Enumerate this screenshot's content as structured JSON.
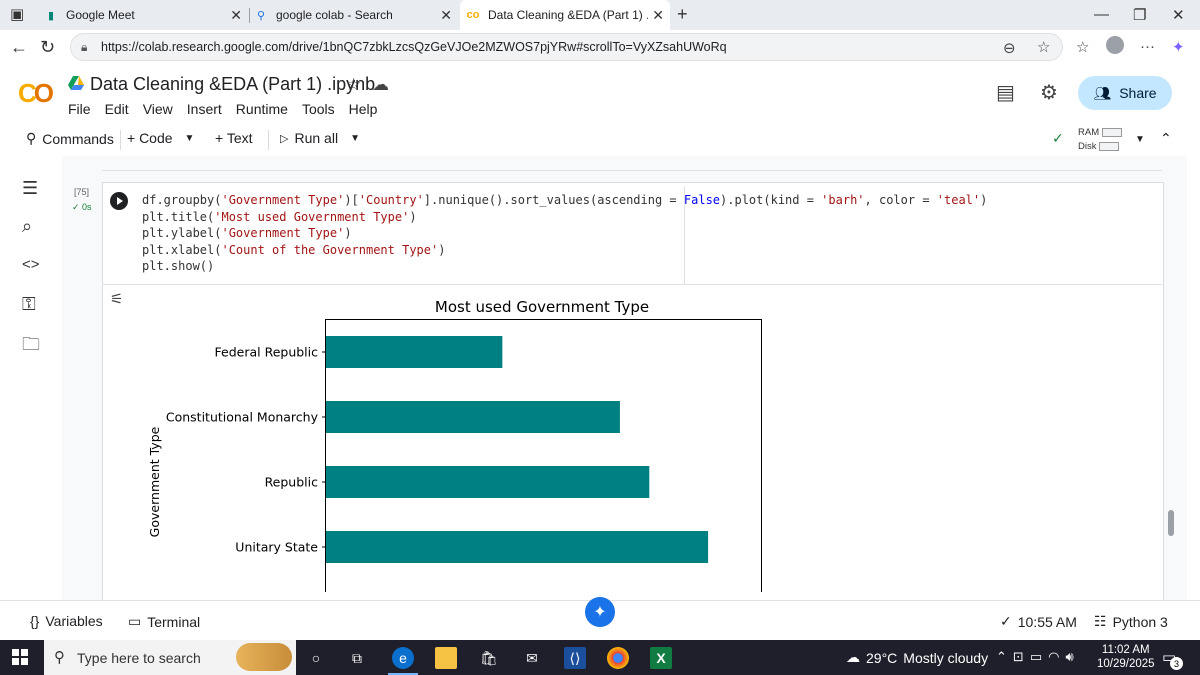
{
  "browser": {
    "tabs": [
      {
        "title": "Google Meet",
        "icon": "google-meet-icon",
        "active": false
      },
      {
        "title": "google colab - Search",
        "icon": "search-icon",
        "active": false
      },
      {
        "title": "Data Cleaning &EDA (Part 1) .ipyn",
        "icon": "colab-icon",
        "active": true
      }
    ],
    "url": "https://colab.research.google.com/drive/1bnQC7zbkLzcsQzGeVJOe2MZWOS7pjYRw#scrollTo=VyXZsahUWoRq"
  },
  "colab": {
    "title": "Data Cleaning &EDA (Part 1) .ipynb",
    "menus": [
      "File",
      "Edit",
      "View",
      "Insert",
      "Runtime",
      "Tools",
      "Help"
    ],
    "share_label": "Share",
    "toolbar": {
      "commands": "Commands",
      "code": "+ Code",
      "text": "+ Text",
      "run_all": "Run all",
      "ram": "RAM",
      "disk": "Disk"
    }
  },
  "cell": {
    "exec_count": "[75]",
    "exec_time": "0s",
    "code_lines": [
      [
        [
          "p",
          "df.groupby("
        ],
        [
          "s",
          "'Government Type'"
        ],
        [
          "p",
          ")["
        ],
        [
          "s",
          "'Country'"
        ],
        [
          "p",
          "].nunique().sort_values(ascending = "
        ],
        [
          "k",
          "False"
        ],
        [
          "p",
          ").plot(kind = "
        ],
        [
          "s",
          "'barh'"
        ],
        [
          "p",
          ", color = "
        ],
        [
          "s",
          "'teal'"
        ],
        [
          "p",
          ")"
        ]
      ],
      [
        [
          "p",
          "plt.title("
        ],
        [
          "s",
          "'Most used Government Type'"
        ],
        [
          "p",
          ")"
        ]
      ],
      [
        [
          "p",
          "plt.ylabel("
        ],
        [
          "s",
          "'Government Type'"
        ],
        [
          "p",
          ")"
        ]
      ],
      [
        [
          "p",
          "plt.xlabel("
        ],
        [
          "s",
          "'Count of the Government Type'"
        ],
        [
          "p",
          ")"
        ]
      ],
      [
        [
          "p",
          "plt.show()"
        ]
      ]
    ]
  },
  "chart_data": {
    "type": "bar",
    "orientation": "horizontal",
    "title": "Most used Government Type",
    "ylabel": "Government Type",
    "xlabel": "",
    "color": "#008080",
    "categories": [
      "Federal Republic",
      "Constitutional Monarchy",
      "Republic",
      "Unitary State"
    ],
    "values": [
      3,
      5,
      5.5,
      6.5
    ],
    "xlim": [
      0,
      7.4
    ]
  },
  "statusbar": {
    "variables": "Variables",
    "terminal": "Terminal",
    "time": "10:55 AM",
    "runtime": "Python 3"
  },
  "taskbar": {
    "search_placeholder": "Type here to search",
    "weather_temp": "29°C",
    "weather_text": "Mostly cloudy",
    "clock_time": "11:02 AM",
    "clock_date": "10/29/2025",
    "notification_count": "3"
  }
}
